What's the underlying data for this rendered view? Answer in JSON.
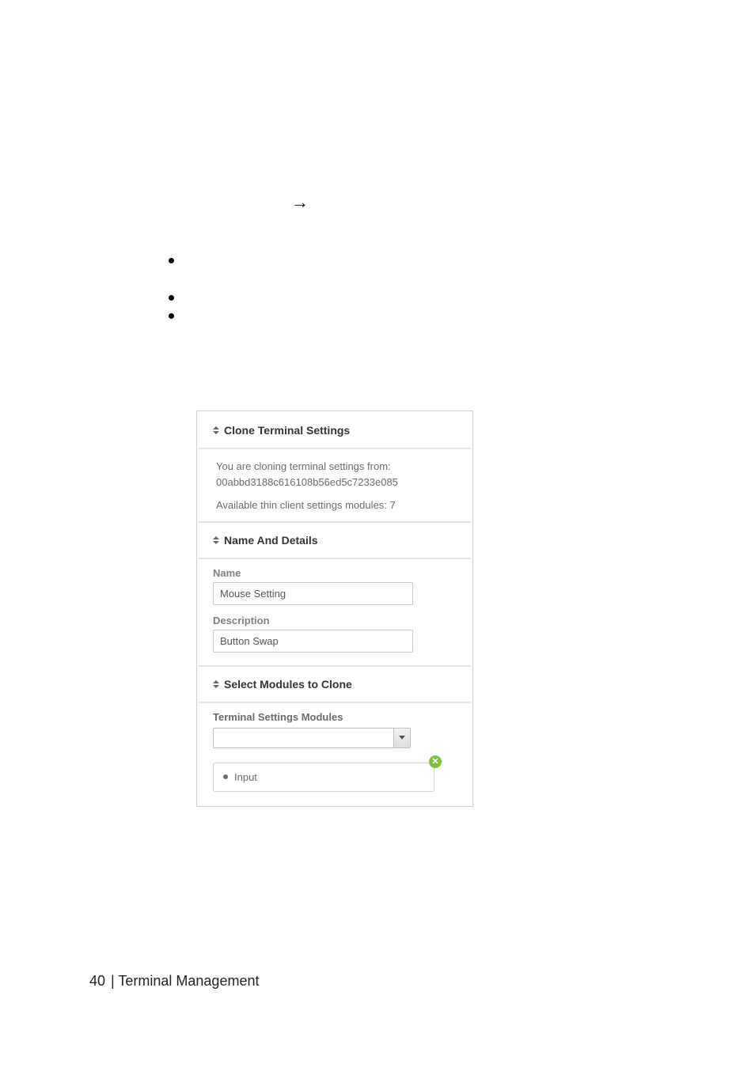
{
  "arrow_glyph": "→",
  "panel": {
    "title": "Clone Terminal Settings",
    "info_line1": "You are cloning terminal settings from:",
    "info_guid": "00abbd3188c616108b56ed5c7233e085",
    "info_available": "Available thin client settings modules: 7",
    "section_name_details": "Name And Details",
    "name_label": "Name",
    "name_value": "Mouse Setting",
    "description_label": "Description",
    "description_value": "Button Swap",
    "section_modules": "Select Modules to Clone",
    "modules_label": "Terminal Settings Modules",
    "module_item": "Input",
    "close_glyph": "✕"
  },
  "footer": {
    "page_number": "40",
    "separator": " | ",
    "section": "Terminal Management"
  }
}
